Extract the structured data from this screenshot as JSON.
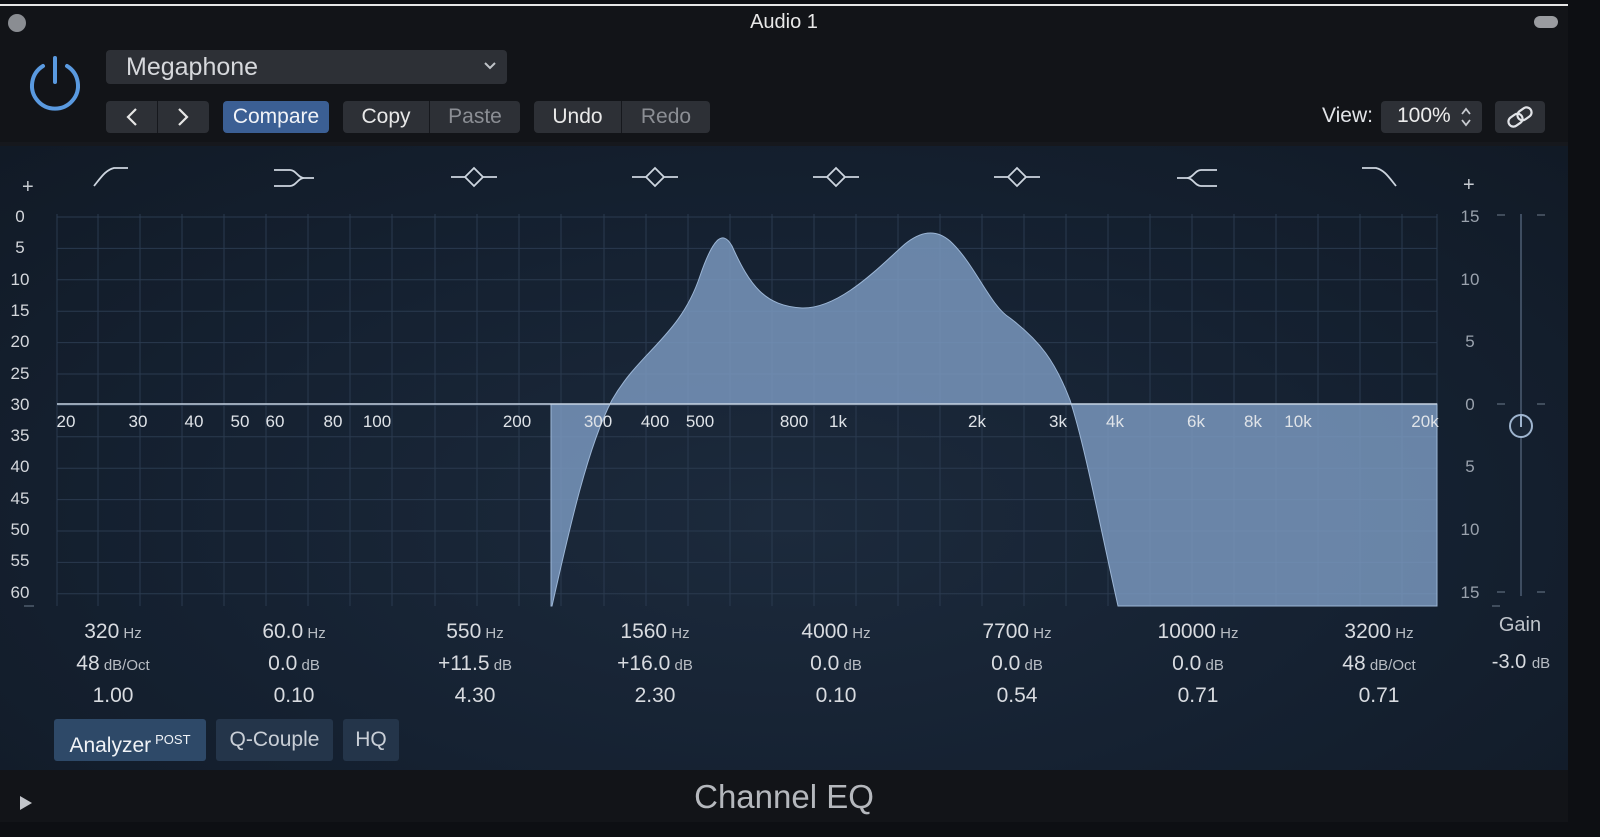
{
  "window": {
    "title": "Audio 1"
  },
  "header": {
    "preset": "Megaphone",
    "buttons": {
      "compare": "Compare",
      "copy": "Copy",
      "paste": "Paste",
      "undo": "Undo",
      "redo": "Redo"
    },
    "view_label": "View:",
    "view_value": "100%"
  },
  "graph": {
    "left_scale": [
      "0",
      "5",
      "10",
      "15",
      "20",
      "25",
      "30",
      "35",
      "40",
      "45",
      "50",
      "55",
      "60"
    ],
    "right_scale": [
      "15",
      "10",
      "5",
      "0",
      "5",
      "10",
      "15"
    ],
    "freq_labels": [
      "20",
      "30",
      "40",
      "50",
      "60",
      "80",
      "100",
      "200",
      "300",
      "400",
      "500",
      "800",
      "1k",
      "2k",
      "3k",
      "4k",
      "6k",
      "8k",
      "10k",
      "20k"
    ],
    "plus_left": "+",
    "plus_right": "+"
  },
  "bands": [
    {
      "freq": "320",
      "freq_unit": "Hz",
      "gain": "48",
      "gain_unit": "dB/Oct",
      "q": "1.00",
      "icon": "low-cut-icon"
    },
    {
      "freq": "60.0",
      "freq_unit": "Hz",
      "gain": "0.0",
      "gain_unit": "dB",
      "q": "0.10",
      "icon": "low-shelf-icon"
    },
    {
      "freq": "550",
      "freq_unit": "Hz",
      "gain": "+11.5",
      "gain_unit": "dB",
      "q": "4.30",
      "icon": "bell-icon"
    },
    {
      "freq": "1560",
      "freq_unit": "Hz",
      "gain": "+16.0",
      "gain_unit": "dB",
      "q": "2.30",
      "icon": "bell-icon"
    },
    {
      "freq": "4000",
      "freq_unit": "Hz",
      "gain": "0.0",
      "gain_unit": "dB",
      "q": "0.10",
      "icon": "bell-icon"
    },
    {
      "freq": "7700",
      "freq_unit": "Hz",
      "gain": "0.0",
      "gain_unit": "dB",
      "q": "0.54",
      "icon": "bell-icon"
    },
    {
      "freq": "10000",
      "freq_unit": "Hz",
      "gain": "0.0",
      "gain_unit": "dB",
      "q": "0.71",
      "icon": "high-shelf-icon"
    },
    {
      "freq": "3200",
      "freq_unit": "Hz",
      "gain": "48",
      "gain_unit": "dB/Oct",
      "q": "0.71",
      "icon": "high-cut-icon"
    }
  ],
  "gain": {
    "label": "Gain",
    "value": "-3.0",
    "unit": "dB"
  },
  "options": {
    "analyzer": "Analyzer",
    "analyzer_sup": "POST",
    "qcouple": "Q-Couple",
    "hq": "HQ"
  },
  "footer": {
    "title": "Channel EQ"
  },
  "colors": {
    "accent": "#3b5f94",
    "curve_fill": "#7d9bc2",
    "power": "#5a9ae0"
  }
}
